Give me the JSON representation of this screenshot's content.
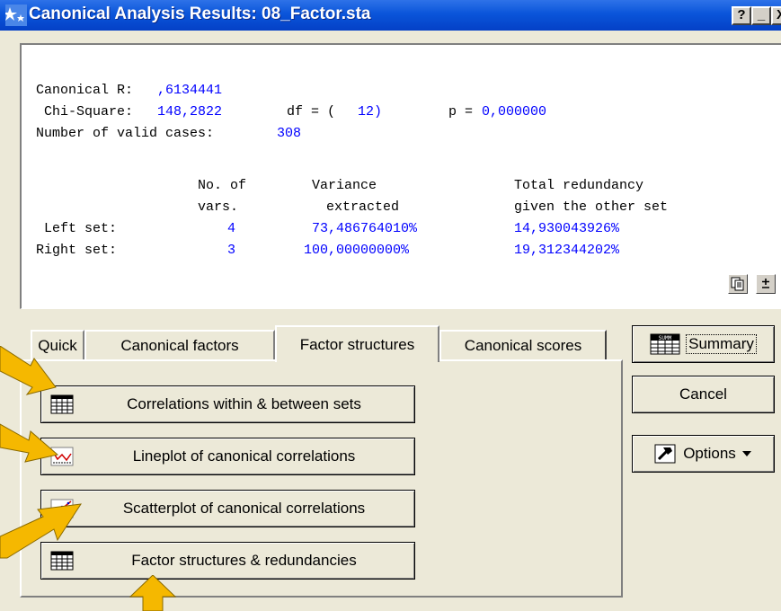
{
  "window": {
    "title": "Canonical Analysis Results: 08_Factor.sta",
    "help_label": "?",
    "minimize_label": "_",
    "close_label": "X"
  },
  "output": {
    "canonical_r_label": "Canonical R:",
    "canonical_r_value": ",6134441",
    "chi_square_label": "Chi-Square:",
    "chi_square_value": "148,2822",
    "df_label": "df = (",
    "df_value": "12)",
    "p_label": "p =",
    "p_value": "0,000000",
    "valid_cases_label": "Number of valid cases:",
    "valid_cases_value": "308",
    "headers": {
      "col1_line1": "No. of",
      "col1_line2": "vars.",
      "col2_line1": "Variance",
      "col2_line2": "extracted",
      "col3_line1": "Total redundancy",
      "col3_line2": "given the other set"
    },
    "rows": [
      {
        "label": "Left set:",
        "vars": "4",
        "variance": "73,486764010%",
        "redundancy": "14,930043926%"
      },
      {
        "label": "Right set:",
        "vars": "3",
        "variance": "100,00000000%",
        "redundancy": "19,312344202%"
      }
    ]
  },
  "tabs": [
    {
      "label": "Quick"
    },
    {
      "label": "Canonical factors"
    },
    {
      "label": "Factor structures"
    },
    {
      "label": "Canonical scores"
    }
  ],
  "active_tab": "Factor structures",
  "panel_buttons": [
    {
      "label": "Correlations within & between sets",
      "icon": "spreadsheet-icon"
    },
    {
      "label": "Lineplot of canonical correlations",
      "icon": "line-chart-icon"
    },
    {
      "label": "Scatterplot of canonical correlations",
      "icon": "scatterplot-icon"
    },
    {
      "label": "Factor structures & redundancies",
      "icon": "spreadsheet-icon"
    }
  ],
  "side_buttons": {
    "summary": "Summary",
    "cancel": "Cancel",
    "options": "Options"
  },
  "colors": {
    "title_bar": "#0a55da",
    "value_text": "#0000ff",
    "arrow": "#f5b800"
  }
}
